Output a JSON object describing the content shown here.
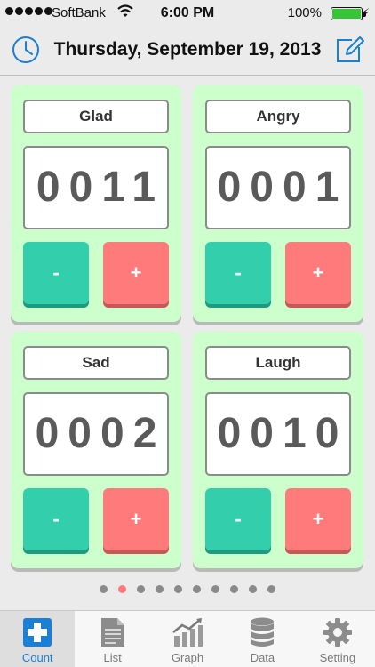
{
  "status_bar": {
    "carrier": "SoftBank",
    "time": "6:00 PM",
    "battery": "100%",
    "battery_level": 1.0
  },
  "header": {
    "date": "Thursday, September 19, 2013"
  },
  "counters": [
    {
      "label": "Glad",
      "count": "0011",
      "minus": "-",
      "plus": "+"
    },
    {
      "label": "Angry",
      "count": "0001",
      "minus": "-",
      "plus": "+"
    },
    {
      "label": "Sad",
      "count": "0002",
      "minus": "-",
      "plus": "+"
    },
    {
      "label": "Laugh",
      "count": "0010",
      "minus": "-",
      "plus": "+"
    }
  ],
  "pagination": {
    "total": 10,
    "current": 2
  },
  "tabs": [
    {
      "label": "Count",
      "icon": "count-plus-icon",
      "active": true
    },
    {
      "label": "List",
      "icon": "list-document-icon",
      "active": false
    },
    {
      "label": "Graph",
      "icon": "graph-chart-icon",
      "active": false
    },
    {
      "label": "Data",
      "icon": "database-icon",
      "active": false
    },
    {
      "label": "Setting",
      "icon": "gear-icon",
      "active": false
    }
  ],
  "colors": {
    "card_bg": "#ccffcc",
    "minus_button": "#33cfad",
    "plus_button": "#ff7a7a",
    "accent_blue": "#1a7fd6",
    "active_dot": "#ff7a7a"
  }
}
